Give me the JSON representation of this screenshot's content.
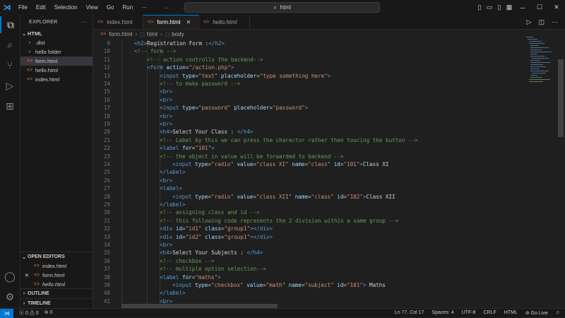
{
  "app": {
    "menu": [
      "File",
      "Edit",
      "Selection",
      "View",
      "Go",
      "Run",
      "···"
    ],
    "search_text": "html"
  },
  "activity_icons": [
    "files-icon",
    "search-icon",
    "source-control-icon",
    "run-debug-icon",
    "extensions-icon",
    "account-icon",
    "settings-gear-icon"
  ],
  "sidebar": {
    "title": "EXPLORER",
    "more": "···",
    "folder": "HTML",
    "items": [
      {
        "label": ".dist",
        "kind": "folder"
      },
      {
        "label": "hello folder",
        "kind": "folder"
      },
      {
        "label": "form.html",
        "kind": "file",
        "selected": true
      },
      {
        "label": "hello.html",
        "kind": "file"
      },
      {
        "label": "index.html",
        "kind": "file"
      }
    ],
    "open_editors": {
      "title": "OPEN EDITORS",
      "items": [
        {
          "label": "index.html",
          "close": ""
        },
        {
          "label": "form.html",
          "close": "✕"
        },
        {
          "label": "hello.html",
          "close": ""
        }
      ]
    },
    "outline": "OUTLINE",
    "timeline": "TIMELINE"
  },
  "tabs": [
    {
      "label": "index.html",
      "active": false,
      "italic": false
    },
    {
      "label": "form.html",
      "active": true,
      "italic": false
    },
    {
      "label": "hello.html",
      "active": false,
      "italic": true
    }
  ],
  "breadcrumbs": [
    "form.html",
    "html",
    "body"
  ],
  "code_lines": [
    {
      "n": "9",
      "ind": 0,
      "html": "<span class=\"tg\">&lt;h2&gt;</span><span class=\"tx\">Registration Form :</span><span class=\"tg\">&lt;/h2&gt;</span>"
    },
    {
      "n": "10",
      "ind": 0,
      "html": "<span class=\"cm\">&lt;!-- form --&gt;</span>"
    },
    {
      "n": "11",
      "ind": 1,
      "html": "<span class=\"cm\">&lt;!-- action controlls the backend--&gt;</span>"
    },
    {
      "n": "12",
      "ind": 1,
      "html": "<span class=\"tg\">&lt;form</span> <span class=\"at\">action</span>=<span class=\"st\">\"/action.php\"</span><span class=\"tg\">&gt;</span>"
    },
    {
      "n": "13",
      "ind": 2,
      "html": "<span class=\"tg\">&lt;input</span> <span class=\"at\">type</span>=<span class=\"st\">\"text\"</span> <span class=\"at\">placeholder</span>=<span class=\"st\">\"type something here\"</span><span class=\"tg\">&gt;</span>"
    },
    {
      "n": "14",
      "ind": 2,
      "html": "<span class=\"cm\">&lt;!-- to make password --&gt;</span>"
    },
    {
      "n": "15",
      "ind": 2,
      "html": "<span class=\"tg\">&lt;br&gt;</span>"
    },
    {
      "n": "16",
      "ind": 2,
      "html": "<span class=\"tg\">&lt;br&gt;</span>"
    },
    {
      "n": "17",
      "ind": 2,
      "html": "<span class=\"tg\">&lt;input</span> <span class=\"at\">type</span>=<span class=\"st\">\"password\"</span> <span class=\"at\">placeholder</span>=<span class=\"st\">\"password\"</span><span class=\"tg\">&gt;</span>"
    },
    {
      "n": "18",
      "ind": 2,
      "html": "<span class=\"tg\">&lt;br&gt;</span>"
    },
    {
      "n": "19",
      "ind": 2,
      "html": "<span class=\"tg\">&lt;br&gt;</span>"
    },
    {
      "n": "20",
      "ind": 2,
      "html": "<span class=\"tg\">&lt;h4&gt;</span><span class=\"tx\">Select Your Class : </span><span class=\"tg\">&lt;/h4&gt;</span>"
    },
    {
      "n": "21",
      "ind": 2,
      "html": "<span class=\"cm\">&lt;!-- Label by this we can press the charector rather then toucing the button --&gt;</span>"
    },
    {
      "n": "22",
      "ind": 2,
      "html": "<span class=\"tg\">&lt;label</span> <span class=\"at\">for</span>=<span class=\"st\">\"101\"</span><span class=\"tg\">&gt;</span>"
    },
    {
      "n": "23",
      "ind": 2,
      "html": "<span class=\"cm\">&lt;!-- the object in value will be forwarded to backend --&gt;</span>"
    },
    {
      "n": "24",
      "ind": 3,
      "html": "<span class=\"tg\">&lt;input</span> <span class=\"at\">type</span>=<span class=\"st\">\"radio\"</span> <span class=\"at\">value</span>=<span class=\"st\">\"class XI\"</span> <span class=\"at\">name</span>=<span class=\"st\">\"class\"</span> <span class=\"at\">id</span>=<span class=\"st\">\"101\"</span><span class=\"tg\">&gt;</span><span class=\"tx\">Class XI</span>"
    },
    {
      "n": "25",
      "ind": 2,
      "html": "<span class=\"tg\">&lt;/label&gt;</span>"
    },
    {
      "n": "26",
      "ind": 2,
      "html": "<span class=\"tg\">&lt;br&gt;</span>"
    },
    {
      "n": "27",
      "ind": 2,
      "html": "<span class=\"tg\">&lt;label&gt;</span>"
    },
    {
      "n": "28",
      "ind": 3,
      "html": "<span class=\"tg\">&lt;input</span> <span class=\"at\">type</span>=<span class=\"st\">\"radio\"</span> <span class=\"at\">value</span>=<span class=\"st\">\"class XII\"</span> <span class=\"at\">name</span>=<span class=\"st\">\"class\"</span> <span class=\"at\">id</span>=<span class=\"st\">\"102\"</span><span class=\"tg\">&gt;</span><span class=\"tx\">Class XII</span>"
    },
    {
      "n": "29",
      "ind": 2,
      "html": "<span class=\"tg\">&lt;/label&gt;</span>"
    },
    {
      "n": "30",
      "ind": 2,
      "html": "<span class=\"cm\">&lt;!-- assigning class and id --&gt;</span>"
    },
    {
      "n": "31",
      "ind": 2,
      "html": "<span class=\"cm\">&lt;!-- this following code represents the 2 division within a same group --&gt;</span>"
    },
    {
      "n": "32",
      "ind": 2,
      "html": "<span class=\"tg\">&lt;div</span> <span class=\"at\">id</span>=<span class=\"st\">\"id1\"</span> <span class=\"at\">class</span>=<span class=\"st\">\"group1\"</span><span class=\"tg\">&gt;&lt;/div&gt;</span>"
    },
    {
      "n": "33",
      "ind": 2,
      "html": "<span class=\"tg\">&lt;div</span> <span class=\"at\">id</span>=<span class=\"st\">\"id2\"</span> <span class=\"at\">class</span>=<span class=\"st\">\"group1\"</span><span class=\"tg\">&gt;&lt;/div&gt;</span>"
    },
    {
      "n": "34",
      "ind": 2,
      "html": "<span class=\"tg\">&lt;br&gt;</span>"
    },
    {
      "n": "35",
      "ind": 2,
      "html": "<span class=\"tg\">&lt;h4&gt;</span><span class=\"tx\">Select Your Subjects : </span><span class=\"tg\">&lt;/h4&gt;</span>"
    },
    {
      "n": "36",
      "ind": 2,
      "html": "<span class=\"cm\">&lt;!-- checkbox --&gt;</span>"
    },
    {
      "n": "37",
      "ind": 2,
      "html": "<span class=\"cm\">&lt;!-- multiple option selection--&gt;</span>"
    },
    {
      "n": "38",
      "ind": 2,
      "html": "<span class=\"tg\">&lt;label</span> <span class=\"at\">for</span>=<span class=\"st\">\"maths\"</span><span class=\"tg\">&gt;</span>"
    },
    {
      "n": "39",
      "ind": 3,
      "html": "<span class=\"tg\">&lt;input</span> <span class=\"at\">type</span>=<span class=\"st\">\"checkbox\"</span> <span class=\"at\">value</span>=<span class=\"st\">\"math\"</span> <span class=\"at\">name</span>=<span class=\"st\">\"subject\"</span> <span class=\"at\">id</span>=<span class=\"st\">\"101\"</span><span class=\"tg\">&gt;</span><span class=\"tx\"> Maths</span>"
    },
    {
      "n": "40",
      "ind": 2,
      "html": "<span class=\"tg\">&lt;/label&gt;</span>"
    },
    {
      "n": "41",
      "ind": 2,
      "html": "<span class=\"tg\">&lt;br&gt;</span>"
    }
  ],
  "status": {
    "remote": "⋊",
    "errors": "0",
    "warnings": "0",
    "ports": "0",
    "position": "Ln 77, Col 17",
    "spaces": "Spaces: 4",
    "encoding": "UTF-8",
    "eol": "CRLF",
    "language": "HTML",
    "live": "Go Live"
  },
  "colors": {
    "accent": "#0078d4",
    "tag": "#569cd6",
    "attribute": "#9cdcfe",
    "string": "#ce9178",
    "comment": "#6a9955",
    "html_file_icon": "#e37933"
  }
}
